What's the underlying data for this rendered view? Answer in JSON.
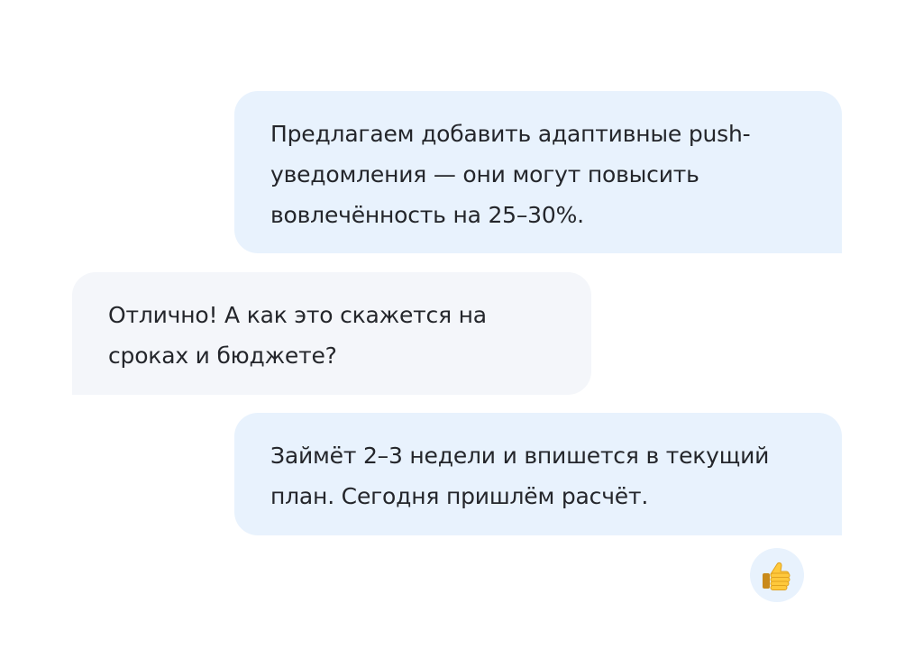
{
  "chat": {
    "messages": [
      {
        "direction": "outgoing",
        "text": "Предлагаем добавить адаптивные push-уведомления — они могут повысить вовлечённость на 25–30%."
      },
      {
        "direction": "incoming",
        "text": "Отлично! А как это скажется на сроках и бюджете?"
      },
      {
        "direction": "outgoing",
        "text": "Займёт 2–3 недели и впишется в текущий план. Сегодня пришлём расчёт."
      }
    ],
    "reaction": {
      "icon": "thumbs-up-icon"
    }
  },
  "colors": {
    "outgoing_bubble": "#e8f2fd",
    "incoming_bubble": "#f4f6fa",
    "text": "#24262b"
  }
}
